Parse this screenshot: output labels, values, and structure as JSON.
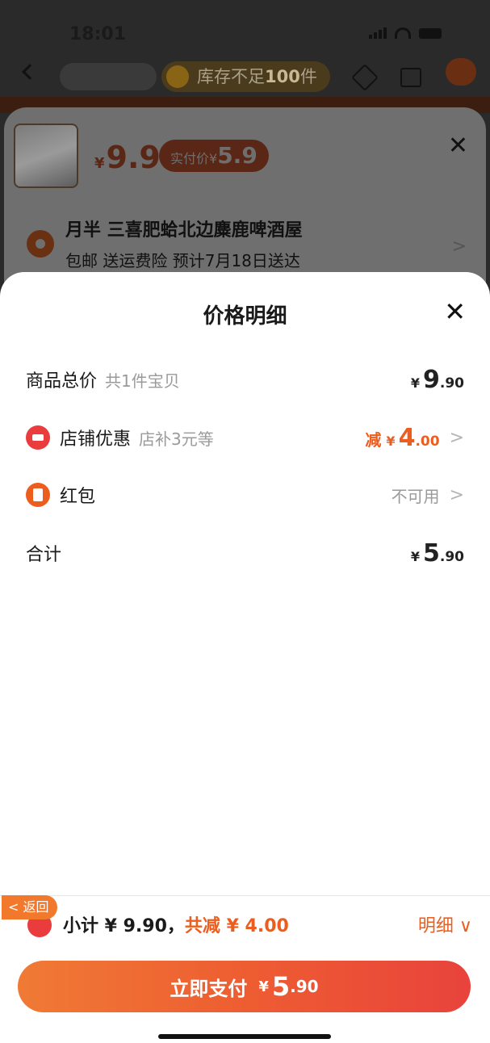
{
  "status": {
    "time": "18:01"
  },
  "nav": {
    "stock_text": "库存不足",
    "stock_count": "100",
    "stock_unit": "件"
  },
  "order": {
    "price_symbol": "¥",
    "price": "9.9",
    "actual_label": "实付价",
    "actual_symbol": "¥",
    "actual_price": "5.9",
    "close": "✕",
    "address_name": "月半 三喜肥蛤北边麋鹿啤酒屋",
    "address_sub": "包邮  送运费险  预计7月18日送达",
    "arrow": ">"
  },
  "detail": {
    "title": "价格明细",
    "close": "✕",
    "rows": {
      "total": {
        "label": "商品总价",
        "sub": "共1件宝贝",
        "yen": "¥",
        "int": "9",
        "dec": ".90"
      },
      "shop": {
        "label": "店铺优惠",
        "sub": "店补3元等",
        "prefix": "减",
        "yen": "¥",
        "int": "4",
        "dec": ".00",
        "chev": ">"
      },
      "hongbao": {
        "label": "红包",
        "value": "不可用",
        "chev": ">"
      },
      "sum": {
        "label": "合计",
        "yen": "¥",
        "int": "5",
        "dec": ".90"
      }
    }
  },
  "bottom": {
    "return_label": "< 返回",
    "subtotal_label": "小计 ¥ 9.90，",
    "discount_label": "共减 ¥ 4.00",
    "detail_link": "明细 ∨",
    "pay_label": "立即支付",
    "pay_yen": "¥",
    "pay_int": "5",
    "pay_dec": ".90"
  },
  "colors": {
    "accent": "#ec5d1e",
    "red": "#ea3c3c"
  }
}
